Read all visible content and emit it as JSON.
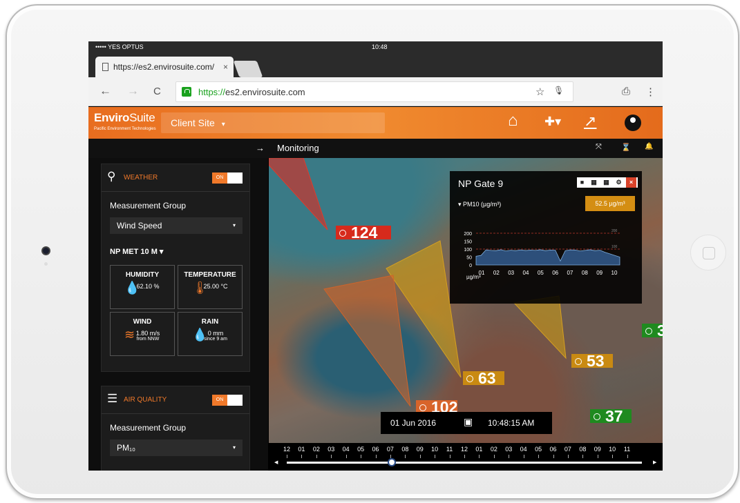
{
  "statusbar": {
    "carrier": "••••• YES OPTUS",
    "time": "10:48"
  },
  "browser": {
    "tab_title": "https://es2.envirosuite.com/",
    "tab_close": "×",
    "url_scheme": "https://",
    "url_host": "es2.envirosuite.com",
    "back": "←",
    "forward": "→",
    "reload": "C",
    "star": "☆",
    "mic": "🎙",
    "share": "⎙",
    "menu": "⋮"
  },
  "app": {
    "logo_bold": "Enviro",
    "logo_rest": "Suite",
    "logo_sub": "Pacific Environment Technologies",
    "site": "Client Site",
    "site_caret": "▾",
    "home_icon": "⌂",
    "puzzle_icon": "✚▾",
    "chart_icon": "↗"
  },
  "subbar": {
    "arrow": "→",
    "title": "Monitoring",
    "icons": [
      "⤧",
      "⌛",
      "🔔"
    ]
  },
  "weather": {
    "title": "WEATHER",
    "toggle": "ON",
    "group_label": "Measurement Group",
    "group_value": "Wind Speed",
    "caret": "▾",
    "station": "NP MET 10 M ▾",
    "tiles": [
      {
        "title": "HUMIDITY",
        "value": "62.10 %",
        "sub": ""
      },
      {
        "title": "TEMPERATURE",
        "value": "25.00 °C",
        "sub": ""
      },
      {
        "title": "WIND",
        "value": "1.80 m/s",
        "sub": "from NNW"
      },
      {
        "title": "RAIN",
        "value": "0 mm",
        "sub": "since 9 am"
      }
    ]
  },
  "air": {
    "title": "AIR QUALITY",
    "toggle": "ON",
    "group_label": "Measurement Group",
    "group_value": "PM₁₀",
    "caret": "▾"
  },
  "markers": [
    {
      "label": "124",
      "color": "#d62a1c"
    },
    {
      "label": "63",
      "color": "#c98a12"
    },
    {
      "label": "53",
      "color": "#c98a12"
    },
    {
      "label": "102",
      "color": "#d8642a"
    },
    {
      "label": "37",
      "color": "#1f8a1f"
    },
    {
      "label": "3",
      "color": "#1f8a1f"
    }
  ],
  "popup": {
    "title": "NP Gate 9",
    "metric": "PM10 (µg/m³)",
    "value": "52.5 µg/m³",
    "unit": "µg/m³",
    "btns": [
      "■",
      "▦",
      "▦",
      "⚙",
      "×"
    ]
  },
  "chart_data": {
    "type": "line",
    "y_ticks": [
      "200",
      "150",
      "100",
      "50",
      "0"
    ],
    "x_ticks": [
      "01",
      "02",
      "03",
      "04",
      "05",
      "06",
      "07",
      "08",
      "09",
      "10"
    ],
    "ref_lines": [
      "200",
      "100"
    ],
    "ylim": [
      0,
      200
    ],
    "series": [
      {
        "values": [
          55,
          60,
          95,
          92,
          90,
          96,
          88,
          93,
          90,
          95,
          91,
          94,
          92,
          96,
          90,
          94,
          93,
          25,
          90,
          95,
          94,
          88,
          92,
          96,
          90,
          93,
          80,
          70,
          60,
          50
        ]
      }
    ]
  },
  "datetime": {
    "date": "01 Jun 2016",
    "time": "10:48:15 AM"
  },
  "timeline": {
    "labels": [
      "12",
      "01",
      "02",
      "03",
      "04",
      "05",
      "06",
      "07",
      "08",
      "09",
      "10",
      "11",
      "12",
      "01",
      "02",
      "03",
      "04",
      "05",
      "06",
      "07",
      "08",
      "09",
      "10",
      "11"
    ],
    "position": 0.295
  }
}
